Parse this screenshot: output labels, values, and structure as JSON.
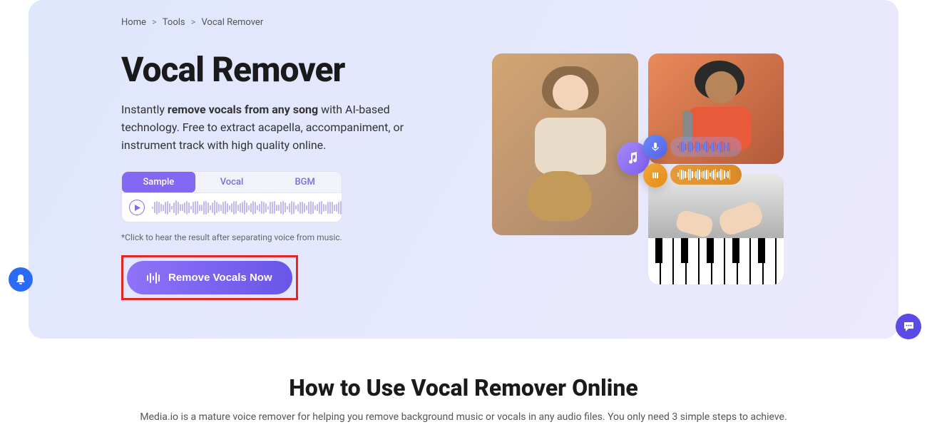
{
  "breadcrumb": {
    "items": [
      "Home",
      "Tools",
      "Vocal Remover"
    ]
  },
  "hero": {
    "title": "Vocal Remover",
    "sub_pre": "Instantly ",
    "sub_bold": "remove vocals from any song",
    "sub_post": " with AI-based technology. Free to extract acapella, accompaniment, or instrument track with high quality online.",
    "tabs": [
      "Sample",
      "Vocal",
      "BGM"
    ],
    "hint": "*Click to hear the result after separating voice from music.",
    "cta_label": "Remove Vocals Now"
  },
  "section2": {
    "title": "How to Use Vocal Remover Online",
    "desc": "Media.io is a mature voice remover for helping you remove background music or vocals in any audio files. You only need 3 simple steps to achieve."
  },
  "icons": {
    "music": "music-icon",
    "mic": "mic-icon",
    "instrument": "instrument-icon"
  }
}
